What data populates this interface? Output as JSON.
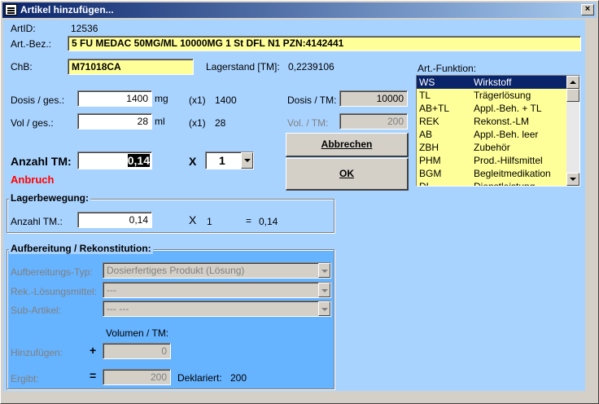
{
  "window": {
    "title": "Artikel hinzufügen...",
    "close_glyph": "×"
  },
  "header": {
    "artid_label": "ArtID:",
    "artid_value": "12536",
    "artbez_label": "Art.-Bez.:",
    "artbez_value": "5 FU MEDAC 50MG/ML 10000MG   1 St DFL N1 PZN:4142441",
    "chb_label": "ChB:",
    "chb_value": "M71018CA",
    "lagerstand_label": "Lagerstand [TM]:",
    "lagerstand_value": "0,2239106"
  },
  "dosis": {
    "label": "Dosis / ges.:",
    "value": "1400",
    "unit": "mg",
    "factor": "(x1)",
    "result": "1400",
    "tm_label": "Dosis / TM:",
    "tm_value": "10000"
  },
  "vol": {
    "label": "Vol / ges.:",
    "value": "28",
    "unit": "ml",
    "factor": "(x1)",
    "result": "28",
    "tm_label": "Vol. / TM:",
    "tm_value": "200"
  },
  "anzahl": {
    "label": "Anzahl TM:",
    "value": "0,14",
    "times": "X",
    "multiplier": "1",
    "warning": "Anbruch"
  },
  "buttons": {
    "abbrechen": "Abbrechen",
    "ok": "OK"
  },
  "art_funktion": {
    "label": "Art.-Funktion:",
    "items": [
      {
        "code": "WS",
        "name": "Wirkstoff",
        "selected": true
      },
      {
        "code": "TL",
        "name": "Trägerlösung"
      },
      {
        "code": "AB+TL",
        "name": "Appl.-Beh. + TL"
      },
      {
        "code": "REK",
        "name": "Rekonst.-LM"
      },
      {
        "code": "AB",
        "name": "Appl.-Beh. leer"
      },
      {
        "code": "ZBH",
        "name": "Zubehör"
      },
      {
        "code": "PHM",
        "name": "Prod.-Hilfsmittel"
      },
      {
        "code": "BGM",
        "name": "Begleitmedikation"
      },
      {
        "code": "DL",
        "name": "Dienstleistung"
      }
    ]
  },
  "lagerbewegung": {
    "title": "Lagerbewegung:",
    "label": "Anzahl TM.:",
    "value": "0,14",
    "times": "X",
    "multiplier": "1",
    "equals": "=",
    "result": "0,14"
  },
  "aufbereitung": {
    "title": "Aufbereitung / Rekonstitution:",
    "typ_label": "Aufbereitungs-Typ:",
    "typ_value": "Dosierfertiges Produkt (Lösung)",
    "rek_label": "Rek.-Lösungsmittel:",
    "rek_value": "---",
    "sub_label": "Sub-Artikel:",
    "sub_value": "---   ---",
    "volumen_label": "Volumen / TM:",
    "hinzu_label": "Hinzufügen:",
    "hinzu_sign": "+",
    "hinzu_value": "0",
    "ergibt_label": "Ergibt:",
    "ergibt_sign": "=",
    "ergibt_value": "200",
    "deklariert_label": "Deklariert:",
    "deklariert_value": "200"
  },
  "colors": {
    "client_bg": "#a9d3ff",
    "highlight_field": "#ffff99",
    "selection": "#0a246a",
    "warning": "#ff0000"
  }
}
